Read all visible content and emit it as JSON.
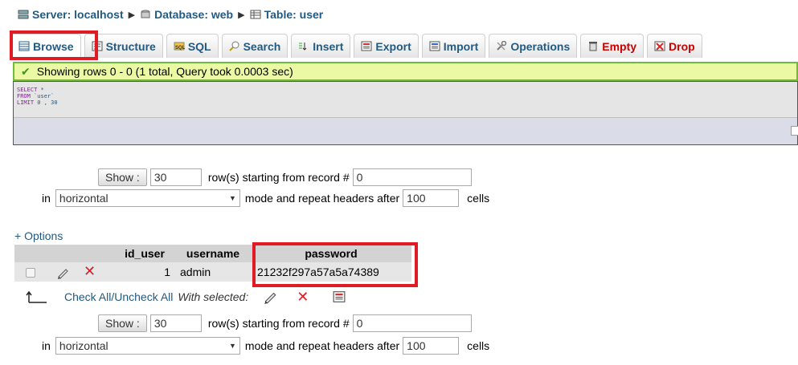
{
  "breadcrumb": {
    "server": "Server: localhost",
    "database": "Database: web",
    "table": "Table: user"
  },
  "tabs": [
    {
      "label": "Browse"
    },
    {
      "label": "Structure"
    },
    {
      "label": "SQL"
    },
    {
      "label": "Search"
    },
    {
      "label": "Insert"
    },
    {
      "label": "Export"
    },
    {
      "label": "Import"
    },
    {
      "label": "Operations"
    },
    {
      "label": "Empty"
    },
    {
      "label": "Drop"
    }
  ],
  "message": "Showing rows 0 - 0 (1 total, Query took 0.0003 sec)",
  "sql": {
    "line1_kw": "SELECT",
    "line1_rest": " *",
    "line2_kw": "FROM",
    "line2_rest": " `user`",
    "line3_kw": "LIMIT",
    "line3_rest": " 0 , 30"
  },
  "nav": {
    "show_label": "Show :",
    "rows_value": "30",
    "rows_text": "row(s) starting from record #",
    "start_value": "0",
    "in_text": "in",
    "mode_value": "horizontal",
    "mode_text": "mode and repeat headers after",
    "repeat_value": "100",
    "cells_text": "cells"
  },
  "options_link": "+ Options",
  "table": {
    "headers": [
      "id_user",
      "username",
      "password"
    ],
    "rows": [
      {
        "id_user": "1",
        "username": "admin",
        "password": "21232f297a57a5a74389"
      }
    ]
  },
  "bulk": {
    "check_all": "Check All",
    "slash": " / ",
    "uncheck_all": "Uncheck All",
    "with_selected": "With selected:"
  },
  "colors": {
    "link": "#235a81",
    "highlight": "#e01b24",
    "success_bg": "#ebf8a4",
    "success_border": "#6ebd3a"
  }
}
